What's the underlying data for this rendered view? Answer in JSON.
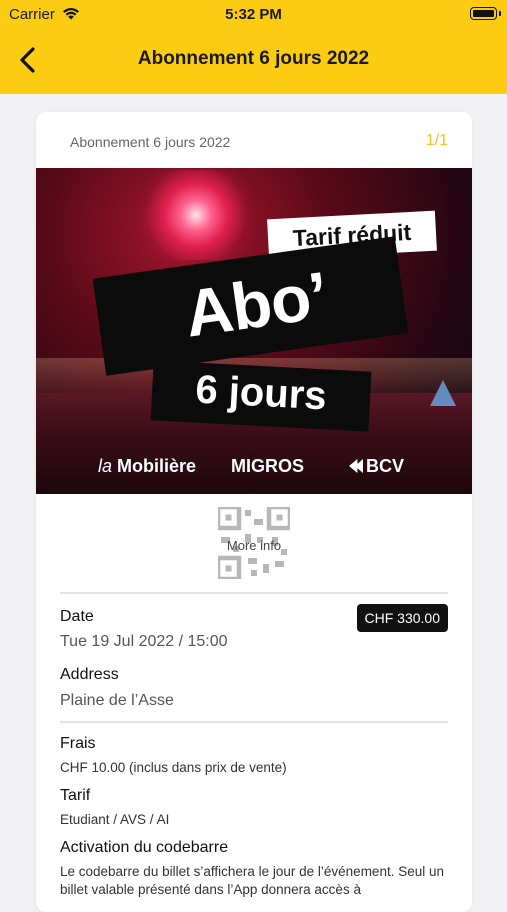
{
  "status": {
    "carrier": "Carrier",
    "time": "5:32 PM"
  },
  "header": {
    "title": "Abonnement 6 jours 2022"
  },
  "ticket": {
    "name": "Abonnement 6 jours 2022",
    "counter": "1/1",
    "banner": {
      "tag": "Tarif réduit",
      "main": "Abo’",
      "sub": "6 jours",
      "sponsors": {
        "mobiliere_prefix": "la",
        "mobiliere": "Mobilière",
        "migros": "MIGROS",
        "bcv": "BCV"
      }
    },
    "more_info": "More info",
    "date": {
      "label": "Date",
      "value": "Tue 19 Jul 2022 / 15:00"
    },
    "price": "CHF 330.00",
    "address": {
      "label": "Address",
      "value": "Plaine de l’Asse"
    },
    "frais": {
      "label": "Frais",
      "value": "CHF 10.00 (inclus dans prix de vente)"
    },
    "tarif": {
      "label": "Tarif",
      "value": "Etudiant / AVS / AI"
    },
    "activation": {
      "label": "Activation du codebarre",
      "text": "Le codebarre du billet s’affichera le jour de l’événement. Seul un billet valable présenté dans l’App donnera accès à"
    }
  },
  "colors": {
    "accent": "#fccc12",
    "counter": "#f2c21a",
    "price_bg": "#111111"
  }
}
